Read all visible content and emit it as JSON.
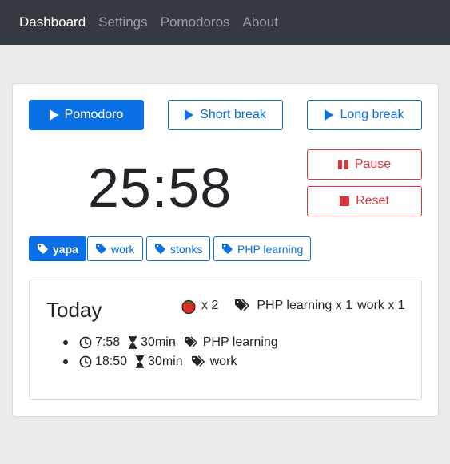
{
  "nav": {
    "items": [
      {
        "label": "Dashboard",
        "active": true
      },
      {
        "label": "Settings",
        "active": false
      },
      {
        "label": "Pomodoros",
        "active": false
      },
      {
        "label": "About",
        "active": false
      }
    ]
  },
  "modes": {
    "pomodoro": "Pomodoro",
    "short_break": "Short break",
    "long_break": "Long break"
  },
  "controls": {
    "pause": "Pause",
    "reset": "Reset"
  },
  "timer": {
    "display": "25:58"
  },
  "tags": [
    {
      "label": "yapa",
      "active": true
    },
    {
      "label": "work",
      "active": false
    },
    {
      "label": "stonks",
      "active": false
    },
    {
      "label": "PHP learning",
      "active": false
    }
  ],
  "today": {
    "title": "Today",
    "pomodoro_count": "x 2",
    "tag_summary": [
      {
        "label": "PHP learning x 1"
      },
      {
        "label": "work x 1"
      }
    ],
    "sessions": [
      {
        "time": "7:58",
        "duration": "30min",
        "tag": "PHP learning"
      },
      {
        "time": "18:50",
        "duration": "30min",
        "tag": "work"
      }
    ]
  },
  "colors": {
    "primary": "#0b6fe5",
    "danger": "#d9363e",
    "navbar": "#343a40",
    "background": "#ebebeb"
  },
  "icons": {
    "mode_buttons": "play-icon",
    "pause": "pause-icon",
    "reset": "stop-icon",
    "tag": "tag-icon",
    "tags": "tags-icon",
    "tomato": "tomato-icon",
    "clock": "clock-icon",
    "duration": "hourglass-icon"
  }
}
